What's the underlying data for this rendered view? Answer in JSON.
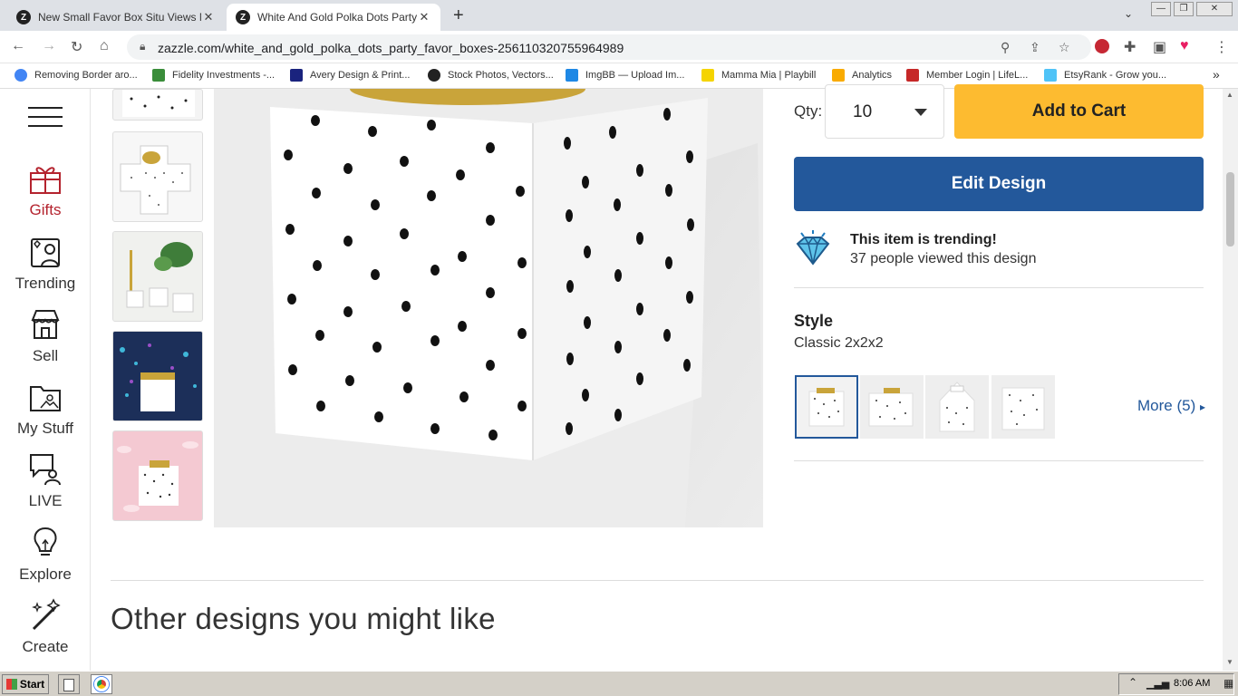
{
  "browser": {
    "tabs": [
      {
        "title": "New Small Favor Box Situ Views No",
        "close": "✕"
      },
      {
        "title": "White And Gold Polka Dots Party Fa",
        "close": "✕"
      }
    ],
    "new_tab": "+",
    "url": "zazzle.com/white_and_gold_polka_dots_party_favor_boxes-256110320755964989",
    "bookmarks": [
      {
        "label": "Removing Border aro...",
        "color": "#4285f4"
      },
      {
        "label": "Fidelity Investments -...",
        "color": "#3a8d3a"
      },
      {
        "label": "Avery Design & Print...",
        "color": "#1a237e"
      },
      {
        "label": "Stock Photos, Vectors...",
        "color": "#222222"
      },
      {
        "label": "ImgBB — Upload Im...",
        "color": "#1e88e5"
      },
      {
        "label": "Mamma Mia | Playbill",
        "color": "#f5d400"
      },
      {
        "label": "Analytics",
        "color": "#f9ab00"
      },
      {
        "label": "Member Login | LifeL...",
        "color": "#c62828"
      },
      {
        "label": "EtsyRank - Grow you...",
        "color": "#4fc3f7"
      }
    ],
    "more_bookmarks": "»"
  },
  "rail": {
    "items": [
      {
        "label": "Gifts",
        "icon": "gift-icon",
        "color": "#b4232e"
      },
      {
        "label": "Trending",
        "icon": "trending-icon",
        "color": "#333333"
      },
      {
        "label": "Sell",
        "icon": "store-icon",
        "color": "#333333"
      },
      {
        "label": "My Stuff",
        "icon": "folder-icon",
        "color": "#333333"
      },
      {
        "label": "LIVE",
        "icon": "live-chat-icon",
        "color": "#333333"
      },
      {
        "label": "Explore",
        "icon": "lightbulb-icon",
        "color": "#333333"
      },
      {
        "label": "Create",
        "icon": "magic-wand-icon",
        "color": "#333333"
      }
    ]
  },
  "product": {
    "qty_label": "Qty:",
    "qty_value": "10",
    "add_to_cart": "Add to Cart",
    "edit_design": "Edit Design",
    "trending_title": "This item is trending!",
    "trending_sub": "37 people viewed this design",
    "style_label": "Style",
    "style_value": "Classic 2x2x2",
    "more_label": "More (5)",
    "more_arrow": "▸"
  },
  "section": {
    "other_title": "Other designs you might like"
  },
  "taskbar": {
    "start": "Start",
    "clock": "8:06 AM"
  },
  "colors": {
    "accent_blue": "#23589b",
    "cart_yellow": "#fdbb30",
    "gift_red": "#b4232e"
  }
}
